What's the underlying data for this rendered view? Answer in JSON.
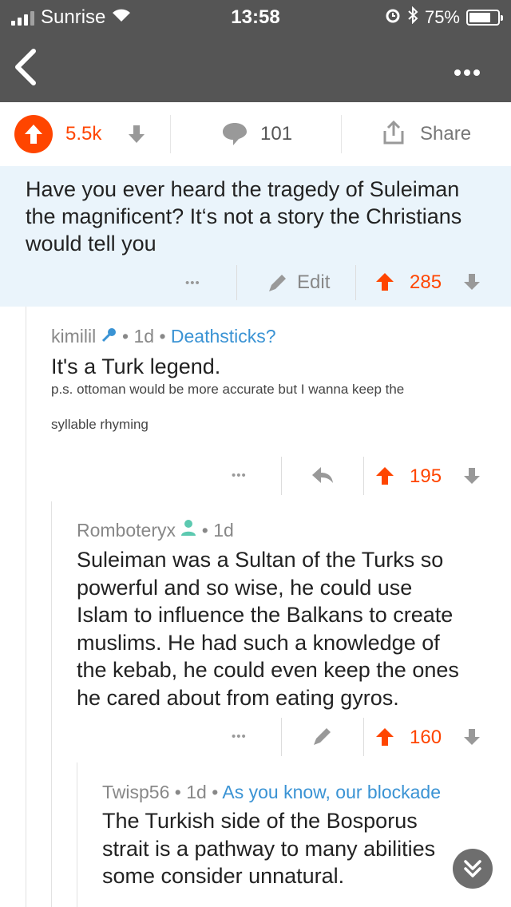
{
  "status_bar": {
    "carrier": "Sunrise",
    "time": "13:58",
    "battery": "75%",
    "battery_level": 0.75
  },
  "header": {
    "back_icon": "chevron-left-icon",
    "more_icon": "more-dots-icon"
  },
  "post_actions": {
    "score": "5.5k",
    "comments": "101",
    "share": "Share",
    "upvote_color": "#ff4500"
  },
  "highlighted_comment": {
    "text": "Have you ever heard the tragedy of Suleiman the magnificent? It‘s not a story the Christians would tell you",
    "edit": "Edit",
    "score": "285",
    "background": "#eaf4fb"
  },
  "comments": [
    {
      "user": "kimilil",
      "age": "1d",
      "flair": "Deathsticks?",
      "text": "It's a Turk legend.",
      "small_text_line1": "p.s. ottoman would be more accurate but I wanna keep the",
      "small_text_line2": "syllable rhyming",
      "score": "195"
    },
    {
      "user": "Romboteryx",
      "age": "1d",
      "text_lines": [
        "Suleiman was a Sultan of the Turks so",
        "powerful and so wise, he could use",
        "Islam to influence the Balkans to create",
        "muslims. He had such a knowledge of",
        "the kebab, he could even keep the ones",
        "he cared about from eating gyros."
      ],
      "score": "160"
    },
    {
      "user": "Twisp56",
      "age": "1d",
      "flair": "As you know, our blockade",
      "text_lines": [
        "The Turkish side of the Bosporus",
        "strait is a pathway to many abilities",
        "some consider unnatural."
      ]
    }
  ],
  "colors": {
    "accent": "#ff4500",
    "flair": "#3a93d4",
    "meta": "#888888"
  }
}
